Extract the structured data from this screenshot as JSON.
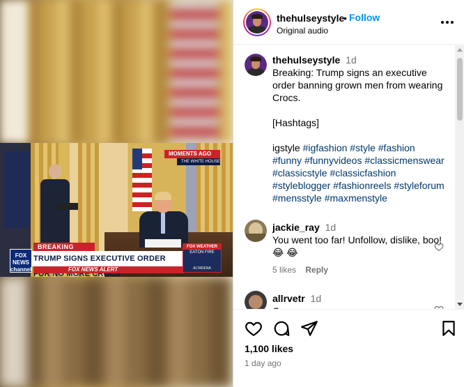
{
  "post": {
    "username": "thehulseystyle",
    "dot": "•",
    "follow_label": "Follow",
    "audio": "Original audio"
  },
  "video": {
    "moments_label": "MOMENTS AGO",
    "moments_sub": "THE WHITE HOUSE",
    "breaking": "BREAKING NEWS",
    "headline": "TRUMP SIGNS EXECUTIVE ORDER FOR NO MORE CROCS",
    "alert": "FOX NEWS ALERT",
    "logo": "FOX NEWS channel",
    "weather_title": "FOX WEATHER",
    "weather_sub": "EATON FIRE",
    "weather_loc": "ALTADENA"
  },
  "caption": {
    "username": "thehulseystyle",
    "time": "1d",
    "text": "Breaking: Trump signs an executive order banning grown men from wearing Crocs.",
    "hashtags_header": "[Hashtags]",
    "hashtags_plain": "igstyle",
    "hashtags": [
      "#igfashion",
      "#style",
      "#fashion",
      "#funny",
      "#funnyvideos",
      "#classicmenswear",
      "#classicstyle",
      "#classicfashion",
      "#styleblogger",
      "#fashionreels",
      "#styleforum",
      "#mensstyle",
      "#maxmenstyle"
    ]
  },
  "comments": [
    {
      "username": "jackie_ray",
      "time": "1d",
      "text": "You went too far! Unfollow, dislike, boo! 😂 😂",
      "likes": "5 likes",
      "reply_label": "Reply"
    },
    {
      "username": "allrvetr",
      "time": "1d",
      "text": "C"
    }
  ],
  "footer": {
    "likes": "1,100 likes",
    "posted": "1 day ago"
  },
  "icons": [
    "heart-icon",
    "comment-icon",
    "share-icon",
    "bookmark-icon",
    "more-icon"
  ]
}
